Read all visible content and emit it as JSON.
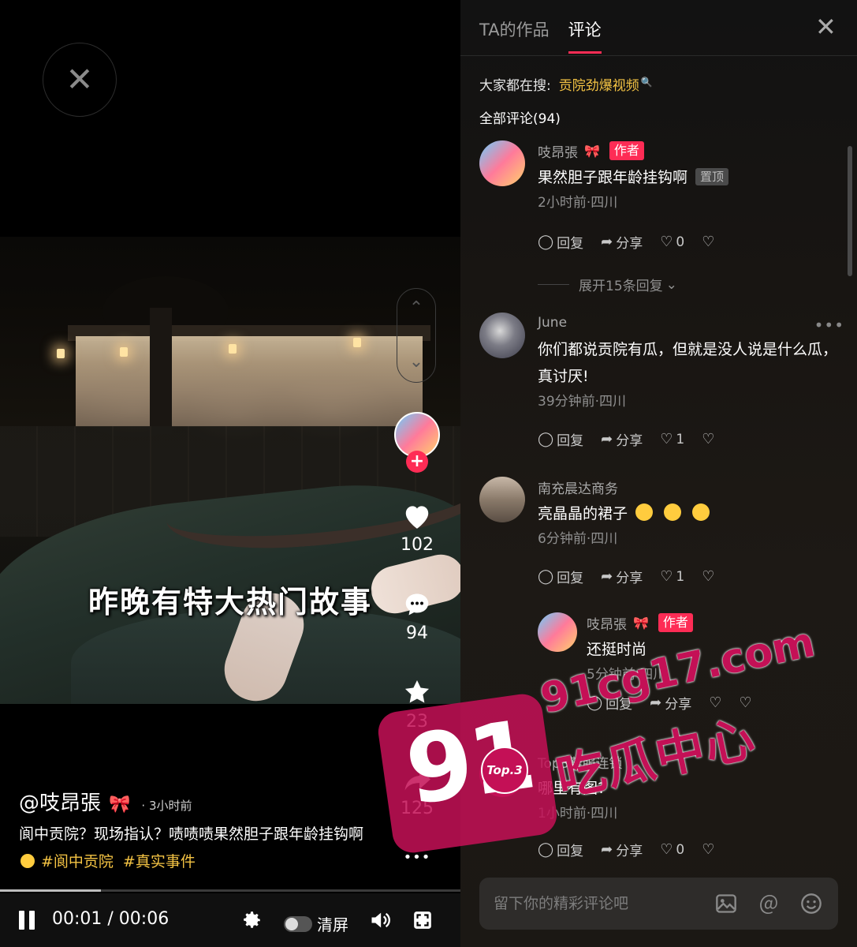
{
  "video": {
    "caption": "昨晚有特大热门故事",
    "close_label": "✕",
    "nav_up": "⌃",
    "nav_down": "⌄",
    "follow_plus": "+",
    "likes": "102",
    "comments": "94",
    "favorites": "23",
    "shares": "125",
    "more": "•••",
    "author": "@吱昂張",
    "author_bow": "🎀",
    "post_time": "· 3小时前",
    "desc_text": "阆中贡院？现场指认？啧啧啧果然胆子跟年龄挂钩啊",
    "tags": [
      "#阆中贡院",
      "#真实事件"
    ],
    "progress": 0.22
  },
  "controls": {
    "time": "00:01 / 00:06",
    "clear_label": "清屏"
  },
  "panel": {
    "tabs": [
      {
        "label": "TA的作品",
        "active": false
      },
      {
        "label": "评论",
        "active": true
      }
    ],
    "close": "✕",
    "hot_search_label": "大家都在搜:",
    "hot_search_keyword": "贡院劲爆视频",
    "all_comments": "全部评论(94)",
    "expand_replies": "展开15条回复",
    "input_placeholder": "留下你的精彩评论吧",
    "reply_label": "回复",
    "share_label": "分享"
  },
  "comments": [
    {
      "user": "吱昂張",
      "bow": "🎀",
      "author_badge": "作者",
      "text": "果然胆子跟年龄挂钩啊",
      "pin": "置顶",
      "meta": "2小时前·四川",
      "likes": "0"
    },
    {
      "user": "June",
      "text": "你们都说贡院有瓜，但就是没人说是什么瓜，真讨厌!",
      "meta": "39分钟前·四川",
      "likes": "1",
      "more": "•••"
    },
    {
      "user": "南充晨达商务",
      "text": "亮晶晶的裙子",
      "meta": "6分钟前·四川",
      "likes": "1"
    },
    {
      "user": "吱昂張",
      "bow": "🎀",
      "author_badge": "作者",
      "text": "还挺时尚",
      "meta": "5分钟前·四川"
    },
    {
      "user": "Top3鞋服连锁",
      "text": "哪里有图?",
      "meta": "1小时前·四川",
      "likes": "0"
    }
  ],
  "watermark": {
    "big": "91",
    "url": "91cg17.com",
    "cn": "吃瓜中心",
    "top": "Top.3"
  },
  "colors": {
    "accent": "#fe2c55",
    "tag": "#f5c444",
    "watermark": "#c41056"
  }
}
